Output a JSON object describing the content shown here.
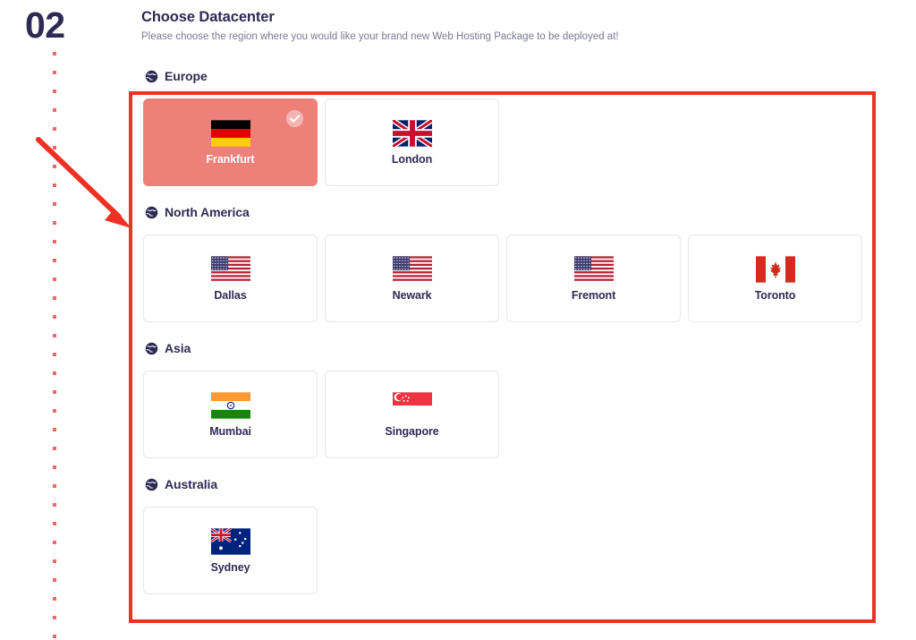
{
  "step": {
    "number": "02",
    "rail_icon": "dotted-vertical-line"
  },
  "header": {
    "title": "Choose Datacenter",
    "subtitle": "Please choose the region where you would like your brand new Web Hosting Package to be deployed at!"
  },
  "colors": {
    "title_text": "#2e2a55",
    "subtitle_text": "#7b7a94",
    "selected_card_bg": "#ed8079",
    "card_border": "#e7e7ef",
    "annotation_red": "#ee3124",
    "rail_dot": "#f1685e"
  },
  "regions": [
    {
      "name": "Europe",
      "icon": "globe-europe-icon",
      "datacenters": [
        {
          "city": "Frankfurt",
          "flag": "flag-germany",
          "selected": true,
          "badge_icon": "check-circle-icon"
        },
        {
          "city": "London",
          "flag": "flag-united-kingdom",
          "selected": false
        }
      ]
    },
    {
      "name": "North America",
      "icon": "globe-americas-icon",
      "datacenters": [
        {
          "city": "Dallas",
          "flag": "flag-united-states",
          "selected": false
        },
        {
          "city": "Newark",
          "flag": "flag-united-states",
          "selected": false
        },
        {
          "city": "Fremont",
          "flag": "flag-united-states",
          "selected": false
        },
        {
          "city": "Toronto",
          "flag": "flag-canada",
          "selected": false
        }
      ]
    },
    {
      "name": "Asia",
      "icon": "globe-asia-icon",
      "datacenters": [
        {
          "city": "Mumbai",
          "flag": "flag-india",
          "selected": false
        },
        {
          "city": "Singapore",
          "flag": "flag-singapore",
          "selected": false
        }
      ]
    },
    {
      "name": "Australia",
      "icon": "globe-asia-icon",
      "datacenters": [
        {
          "city": "Sydney",
          "flag": "flag-australia",
          "selected": false
        }
      ]
    }
  ],
  "annotations": {
    "highlight_box": "red-rectangle-highlight",
    "pointer": "red-arrow-pointing-to-cards"
  }
}
